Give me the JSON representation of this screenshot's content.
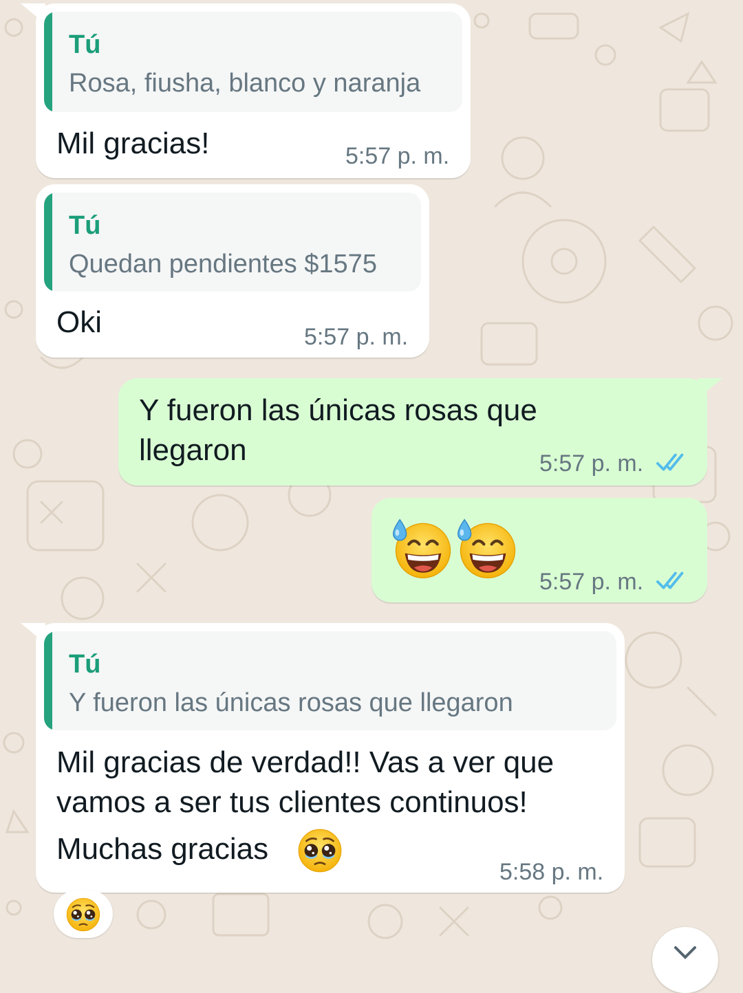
{
  "colors": {
    "wallpaper": "#efe7dd",
    "incoming_bubble": "#ffffff",
    "outgoing_bubble": "#d9fdd3",
    "quote_author": "#1b9e79",
    "read_ticks": "#53bdeb"
  },
  "messages": [
    {
      "direction": "incoming",
      "quote": {
        "author": "Tú",
        "text": "Rosa, fiusha, blanco y naranja"
      },
      "text": "Mil gracias!",
      "time": "5:57 p. m."
    },
    {
      "direction": "incoming",
      "quote": {
        "author": "Tú",
        "text": "Quedan pendientes $1575"
      },
      "text": "Oki",
      "time": "5:57 p. m."
    },
    {
      "direction": "outgoing",
      "lines": [
        "Y fueron las únicas rosas que",
        "llegaron"
      ],
      "time": "5:57 p. m.",
      "status_icon": "double-check-read-icon"
    },
    {
      "direction": "outgoing",
      "emoji": [
        "grinning-face-with-sweat-emoji",
        "grinning-face-with-sweat-emoji"
      ],
      "time": "5:57 p. m.",
      "status_icon": "double-check-read-icon"
    },
    {
      "direction": "incoming",
      "quote": {
        "author": "Tú",
        "text": "Y fueron las únicas rosas que llegaron"
      },
      "lines": [
        "Mil gracias de verdad!! Vas a ver que",
        "vamos a ser tus clientes continuos!",
        "Muchas gracias"
      ],
      "trailing_emoji": "pleading-face-emoji",
      "time": "5:58 p. m.",
      "reaction": "pleading-face-emoji"
    }
  ],
  "scroll_button_icon": "chevron-down-icon"
}
